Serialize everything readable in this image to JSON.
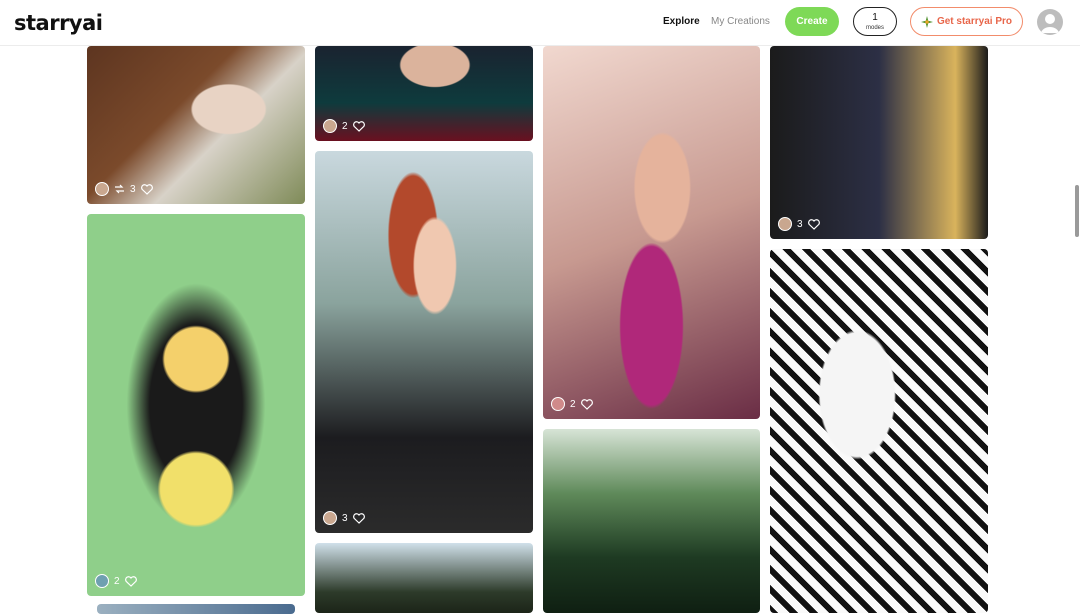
{
  "header": {
    "logo": "starryai",
    "nav": {
      "explore": "Explore",
      "my_creations": "My Creations"
    },
    "create_label": "Create",
    "modes": {
      "count": "1",
      "label": "modes"
    },
    "pro_label": "Get starryai Pro"
  },
  "cards": [
    {
      "count": "3"
    },
    {
      "count": "2"
    },
    {
      "count": "2"
    },
    {
      "count": "3"
    },
    {
      "count": "2"
    },
    {
      "count": "3"
    }
  ]
}
